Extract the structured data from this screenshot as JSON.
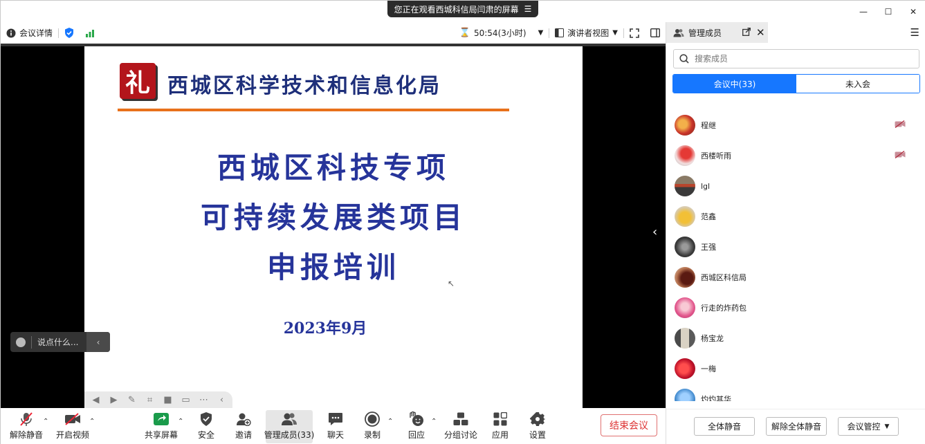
{
  "banner": {
    "text": "您正在观看西城科信局闫肃的屏幕",
    "icon": "menu-icon"
  },
  "topbar": {
    "meeting_info": "会议详情",
    "timer": "50:54(3小时)",
    "view_mode": "演讲者视图"
  },
  "slide": {
    "logo_char": "礼",
    "org_title": "西城区科学技术和信息化局",
    "line1": "西城区科技专项",
    "line2": "可持续发展类项目",
    "line3": "申报培训",
    "date": "2023年9月"
  },
  "chat": {
    "placeholder": "说点什么..."
  },
  "toolbar": {
    "unmute": "解除静音",
    "start_video": "开启视频",
    "share_screen": "共享屏幕",
    "security": "安全",
    "invite": "邀请",
    "manage_members": "管理成员(33)",
    "chat": "聊天",
    "record": "录制",
    "reactions": "回应",
    "breakout": "分组讨论",
    "apps": "应用",
    "settings": "设置",
    "end_meeting": "结束会议"
  },
  "panel": {
    "title": "管理成员",
    "search_placeholder": "搜索成员",
    "tab_in_meeting": "会议中(33)",
    "tab_not_joined": "未入会",
    "members": [
      {
        "name": "程继",
        "avatar_color": "#d9534f",
        "camera_off": true
      },
      {
        "name": "西楼听雨",
        "avatar_color": "#c62828",
        "camera_off": true
      },
      {
        "name": "lgl",
        "avatar_color": "#6d5a4a",
        "camera_off": false
      },
      {
        "name": "范鑫",
        "avatar_color": "#e0a020",
        "camera_off": false
      },
      {
        "name": "王强",
        "avatar_color": "#555555",
        "camera_off": false
      },
      {
        "name": "西城区科信局",
        "avatar_color": "#8a3b2f",
        "camera_off": false
      },
      {
        "name": "行走的炸药包",
        "avatar_color": "#d4507a",
        "camera_off": false
      },
      {
        "name": "杨宝龙",
        "avatar_color": "#6f6f6f",
        "camera_off": false
      },
      {
        "name": "一梅",
        "avatar_color": "#d01c2b",
        "camera_off": false
      },
      {
        "name": "灼灼其华",
        "avatar_color": "#3a84c9",
        "camera_off": false
      }
    ],
    "mute_all": "全体静音",
    "unmute_all": "解除全体静音",
    "meeting_control": "会议管控"
  },
  "colors": {
    "accent": "#1677ff",
    "end_red": "#dd3333",
    "slide_blue": "#26349a",
    "rule_orange": "#e8711b"
  }
}
